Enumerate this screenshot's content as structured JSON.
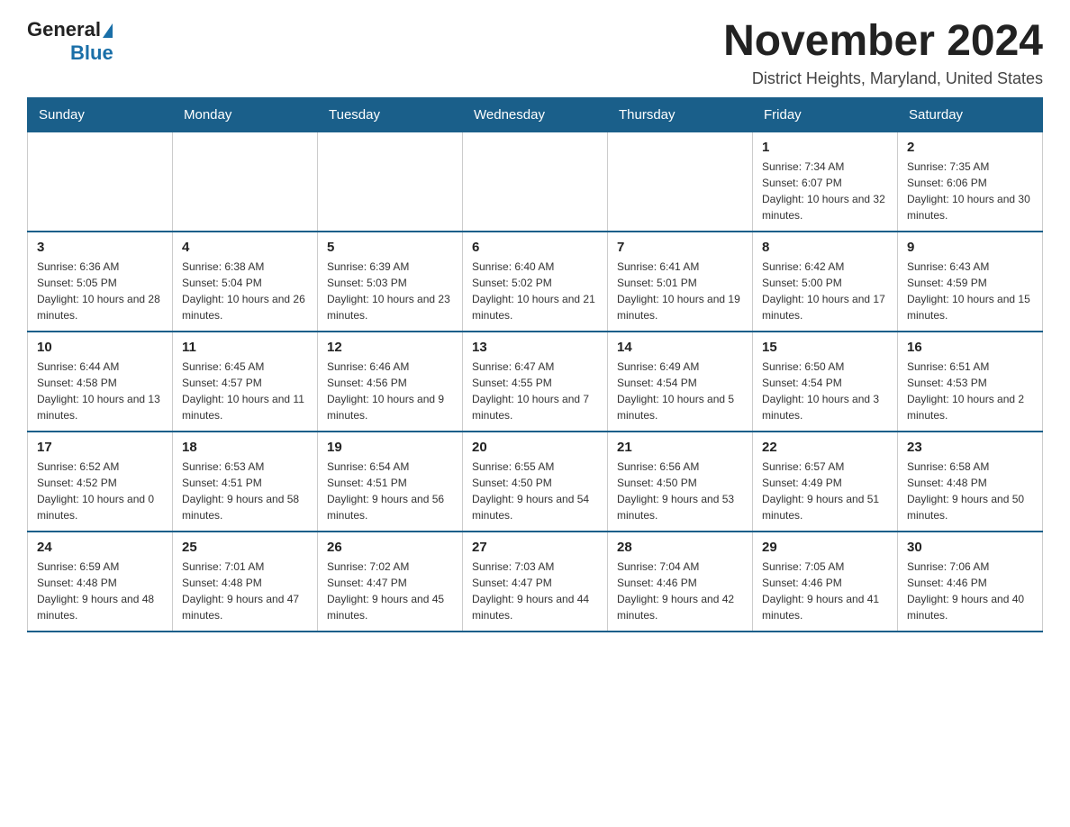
{
  "header": {
    "logo_general": "General",
    "logo_blue": "Blue",
    "main_title": "November 2024",
    "subtitle": "District Heights, Maryland, United States"
  },
  "weekdays": [
    "Sunday",
    "Monday",
    "Tuesday",
    "Wednesday",
    "Thursday",
    "Friday",
    "Saturday"
  ],
  "weeks": [
    [
      {
        "day": "",
        "info": ""
      },
      {
        "day": "",
        "info": ""
      },
      {
        "day": "",
        "info": ""
      },
      {
        "day": "",
        "info": ""
      },
      {
        "day": "",
        "info": ""
      },
      {
        "day": "1",
        "info": "Sunrise: 7:34 AM\nSunset: 6:07 PM\nDaylight: 10 hours and 32 minutes."
      },
      {
        "day": "2",
        "info": "Sunrise: 7:35 AM\nSunset: 6:06 PM\nDaylight: 10 hours and 30 minutes."
      }
    ],
    [
      {
        "day": "3",
        "info": "Sunrise: 6:36 AM\nSunset: 5:05 PM\nDaylight: 10 hours and 28 minutes."
      },
      {
        "day": "4",
        "info": "Sunrise: 6:38 AM\nSunset: 5:04 PM\nDaylight: 10 hours and 26 minutes."
      },
      {
        "day": "5",
        "info": "Sunrise: 6:39 AM\nSunset: 5:03 PM\nDaylight: 10 hours and 23 minutes."
      },
      {
        "day": "6",
        "info": "Sunrise: 6:40 AM\nSunset: 5:02 PM\nDaylight: 10 hours and 21 minutes."
      },
      {
        "day": "7",
        "info": "Sunrise: 6:41 AM\nSunset: 5:01 PM\nDaylight: 10 hours and 19 minutes."
      },
      {
        "day": "8",
        "info": "Sunrise: 6:42 AM\nSunset: 5:00 PM\nDaylight: 10 hours and 17 minutes."
      },
      {
        "day": "9",
        "info": "Sunrise: 6:43 AM\nSunset: 4:59 PM\nDaylight: 10 hours and 15 minutes."
      }
    ],
    [
      {
        "day": "10",
        "info": "Sunrise: 6:44 AM\nSunset: 4:58 PM\nDaylight: 10 hours and 13 minutes."
      },
      {
        "day": "11",
        "info": "Sunrise: 6:45 AM\nSunset: 4:57 PM\nDaylight: 10 hours and 11 minutes."
      },
      {
        "day": "12",
        "info": "Sunrise: 6:46 AM\nSunset: 4:56 PM\nDaylight: 10 hours and 9 minutes."
      },
      {
        "day": "13",
        "info": "Sunrise: 6:47 AM\nSunset: 4:55 PM\nDaylight: 10 hours and 7 minutes."
      },
      {
        "day": "14",
        "info": "Sunrise: 6:49 AM\nSunset: 4:54 PM\nDaylight: 10 hours and 5 minutes."
      },
      {
        "day": "15",
        "info": "Sunrise: 6:50 AM\nSunset: 4:54 PM\nDaylight: 10 hours and 3 minutes."
      },
      {
        "day": "16",
        "info": "Sunrise: 6:51 AM\nSunset: 4:53 PM\nDaylight: 10 hours and 2 minutes."
      }
    ],
    [
      {
        "day": "17",
        "info": "Sunrise: 6:52 AM\nSunset: 4:52 PM\nDaylight: 10 hours and 0 minutes."
      },
      {
        "day": "18",
        "info": "Sunrise: 6:53 AM\nSunset: 4:51 PM\nDaylight: 9 hours and 58 minutes."
      },
      {
        "day": "19",
        "info": "Sunrise: 6:54 AM\nSunset: 4:51 PM\nDaylight: 9 hours and 56 minutes."
      },
      {
        "day": "20",
        "info": "Sunrise: 6:55 AM\nSunset: 4:50 PM\nDaylight: 9 hours and 54 minutes."
      },
      {
        "day": "21",
        "info": "Sunrise: 6:56 AM\nSunset: 4:50 PM\nDaylight: 9 hours and 53 minutes."
      },
      {
        "day": "22",
        "info": "Sunrise: 6:57 AM\nSunset: 4:49 PM\nDaylight: 9 hours and 51 minutes."
      },
      {
        "day": "23",
        "info": "Sunrise: 6:58 AM\nSunset: 4:48 PM\nDaylight: 9 hours and 50 minutes."
      }
    ],
    [
      {
        "day": "24",
        "info": "Sunrise: 6:59 AM\nSunset: 4:48 PM\nDaylight: 9 hours and 48 minutes."
      },
      {
        "day": "25",
        "info": "Sunrise: 7:01 AM\nSunset: 4:48 PM\nDaylight: 9 hours and 47 minutes."
      },
      {
        "day": "26",
        "info": "Sunrise: 7:02 AM\nSunset: 4:47 PM\nDaylight: 9 hours and 45 minutes."
      },
      {
        "day": "27",
        "info": "Sunrise: 7:03 AM\nSunset: 4:47 PM\nDaylight: 9 hours and 44 minutes."
      },
      {
        "day": "28",
        "info": "Sunrise: 7:04 AM\nSunset: 4:46 PM\nDaylight: 9 hours and 42 minutes."
      },
      {
        "day": "29",
        "info": "Sunrise: 7:05 AM\nSunset: 4:46 PM\nDaylight: 9 hours and 41 minutes."
      },
      {
        "day": "30",
        "info": "Sunrise: 7:06 AM\nSunset: 4:46 PM\nDaylight: 9 hours and 40 minutes."
      }
    ]
  ]
}
